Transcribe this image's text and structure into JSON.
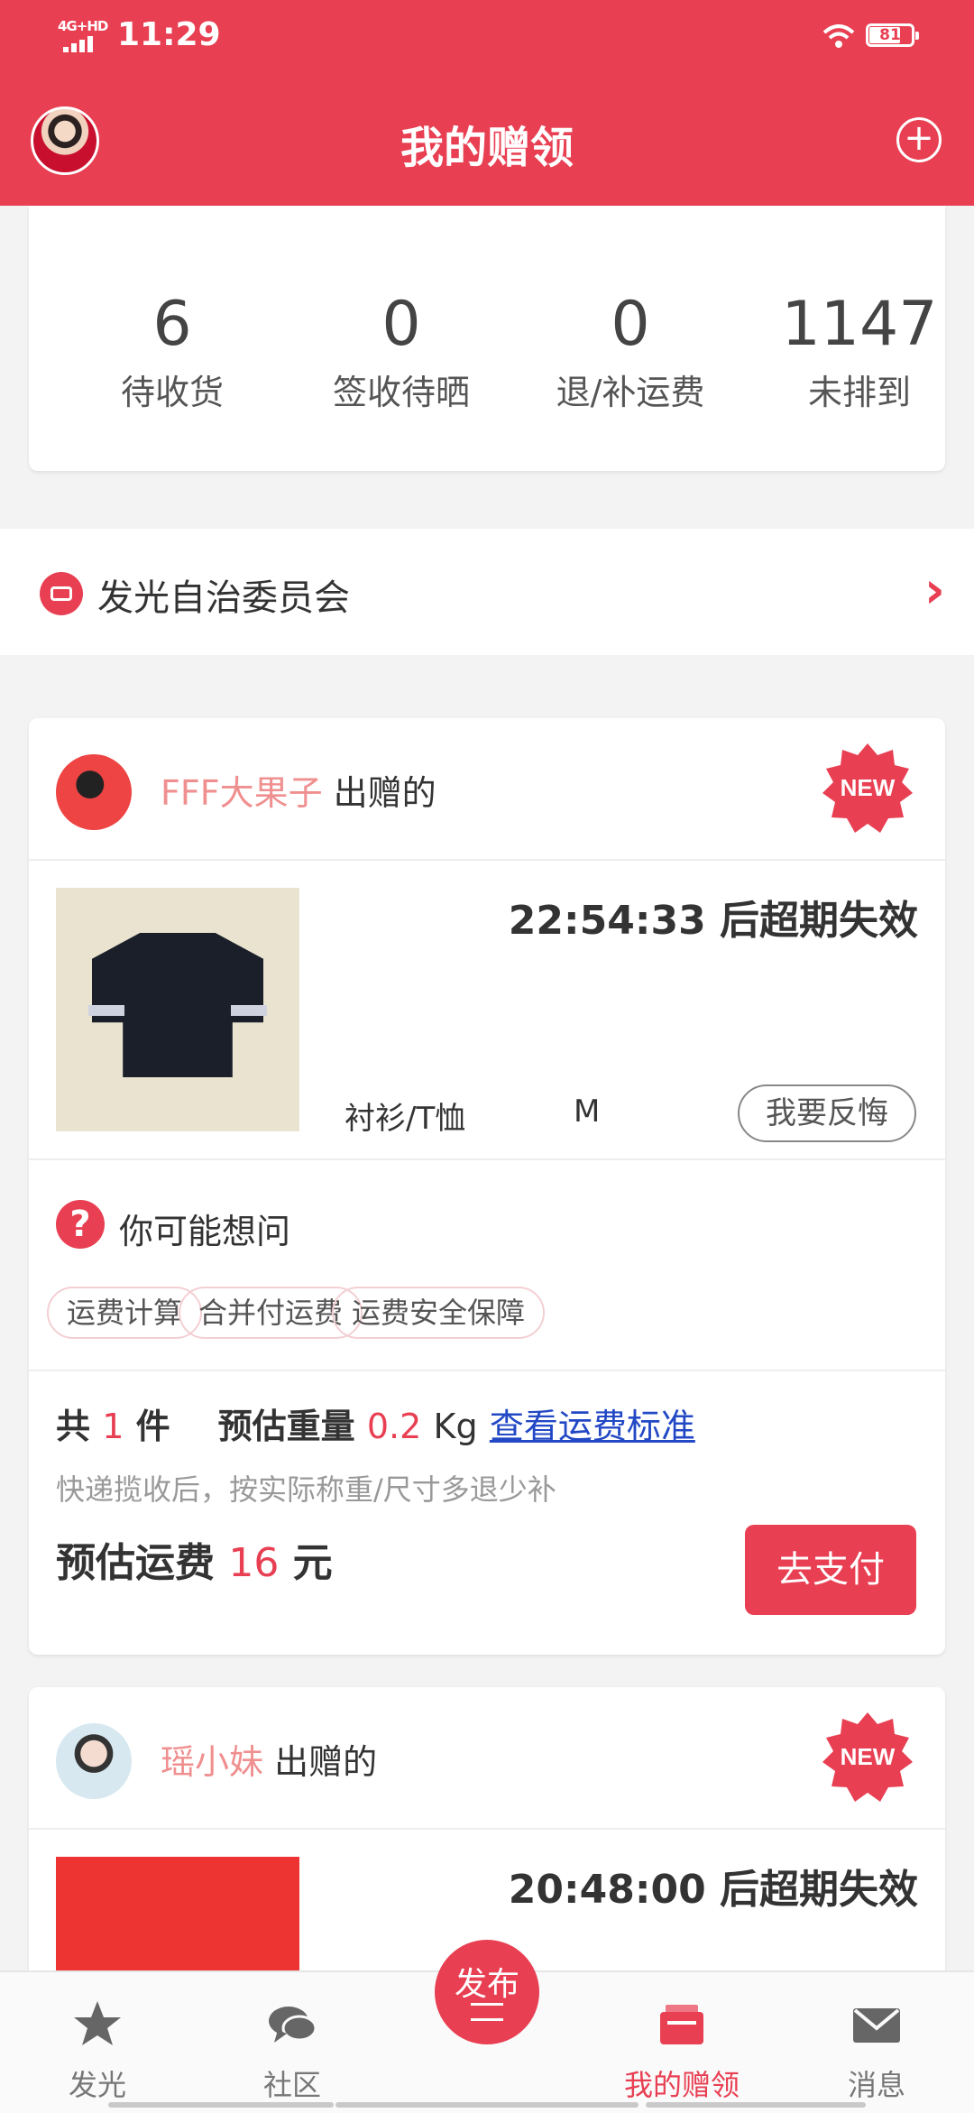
{
  "status_bar": {
    "time": "11:29",
    "network": "4G+HD",
    "battery": "81"
  },
  "header": {
    "title": "我的赠领"
  },
  "stats": [
    {
      "value": "6",
      "label": "待收货"
    },
    {
      "value": "0",
      "label": "签收待晒"
    },
    {
      "value": "0",
      "label": "退/补运费"
    },
    {
      "value": "1147",
      "label": "未排到"
    }
  ],
  "committee": {
    "label": "发光自治委员会"
  },
  "cards": [
    {
      "giver_name": "FFF大果子",
      "giver_suffix": " 出赠的",
      "badge": "NEW",
      "countdown": "22:54:33 后超期失效",
      "category": "衬衫/T恤",
      "size": "M",
      "regret_label": "我要反悔",
      "faq": {
        "title": "你可能想问",
        "tags": [
          "运费计算",
          "合并付运费",
          "运费安全保障"
        ]
      },
      "summary": {
        "count_prefix": "共",
        "count": "1",
        "count_suffix": "件",
        "weight_label": "预估重量",
        "weight": "0.2",
        "weight_unit": "Kg",
        "link": "查看运费标准"
      },
      "note": "快递揽收后，按实际称重/尺寸多退少补",
      "fee": {
        "label": "预估运费",
        "amount": "16",
        "unit": "元"
      },
      "pay_label": "去支付"
    },
    {
      "giver_name": "瑶小妹",
      "giver_suffix": " 出赠的",
      "badge": "NEW",
      "countdown": "20:48:00 后超期失效"
    }
  ],
  "bottom_nav": {
    "items": [
      {
        "label": "发光",
        "icon": "star-icon"
      },
      {
        "label": "社区",
        "icon": "chat-bubble-icon"
      },
      {
        "label": "我的赠领",
        "icon": "gift-box-icon"
      },
      {
        "label": "消息",
        "icon": "mail-icon"
      }
    ],
    "publish": "发布"
  },
  "colors": {
    "accent": "#e83f52",
    "link": "#2248c5",
    "giver_name": "#f08f8f"
  }
}
